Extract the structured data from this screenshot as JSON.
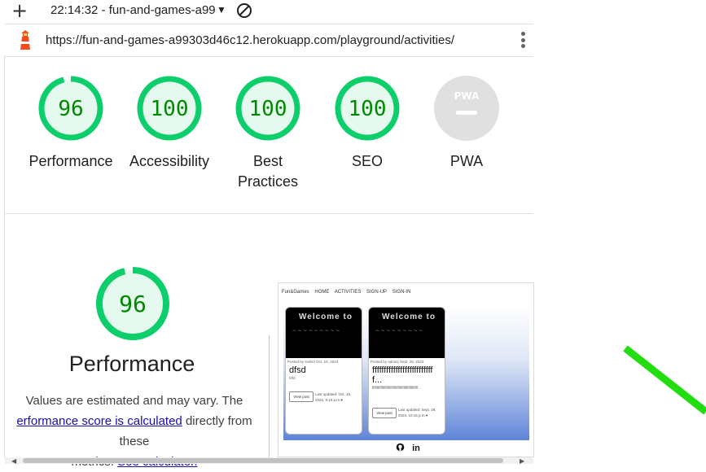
{
  "topbar": {
    "title": "22:14:32 - fun-and-games-a99",
    "plus_icon": "plus-icon",
    "dropdown_icon": "triangle-down-icon",
    "noentry_icon": "no-entry-icon"
  },
  "urlbar": {
    "url": "https://fun-and-games-a99303d46c12.herokuapp.com/playground/activities/",
    "icon": "lighthouse-icon",
    "menu_icon": "kebab-menu-icon"
  },
  "scores": [
    {
      "value": "96",
      "label": "Performance",
      "fraction": 0.96
    },
    {
      "value": "100",
      "label": "Accessibility",
      "fraction": 1.0
    },
    {
      "value": "100",
      "label": "Best Practices",
      "fraction": 1.0
    },
    {
      "value": "100",
      "label": "SEO",
      "fraction": 1.0
    },
    {
      "value": "PWA",
      "label": "PWA",
      "fraction": 0
    }
  ],
  "detail": {
    "score": "96",
    "score_fraction": 0.96,
    "title": "Performance",
    "desc_line1": "Values are estimated and may vary. The",
    "desc_link1": "erformance score is calculated",
    "desc_mid": " directly from these",
    "desc_line3_pre": "metrics. ",
    "desc_link2": "See calculator."
  },
  "thumbnail": {
    "nav": [
      "Fun&Games",
      "HOME",
      "ACTIVITIES",
      "SIGN-UP",
      "SIGN-IN"
    ],
    "cards": [
      {
        "image_title": "Welcome to",
        "image_sub": "~~~~~~~~~",
        "meta": "Posted by smilie| Oct. 15, 2023",
        "title": "dfsd",
        "text": "fdfd",
        "button": "View post",
        "updated": "Last updated: Oct. 15, 2023, 8:10 p.m.♥"
      },
      {
        "image_title": "Welcome to",
        "image_sub": "~~~~~~~~~",
        "meta": "Posted by admin| Sept. 28, 2023",
        "title": "fffffffffffffffffffffffffff...",
        "text": "ffffffffffffffffffffffffffffffffffffffffffffffff...",
        "button": "View post",
        "updated": "Last updated: Sept. 28, 2023, 10:15 p.m.♥"
      }
    ],
    "footer_icons": [
      "github-icon",
      "linkedin-icon"
    ],
    "footer_text": "in"
  },
  "colors": {
    "pass_green": "#0cce6b",
    "pass_bg": "#e6f9ee",
    "pass_text": "#008800",
    "pwa_grey": "#e0e0e0"
  }
}
